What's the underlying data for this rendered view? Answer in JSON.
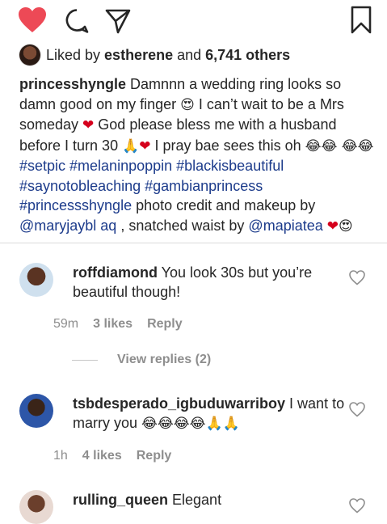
{
  "likes": {
    "prefix": "Liked by ",
    "user": "estherene",
    "mid": " and ",
    "count": "6,741 others"
  },
  "caption": {
    "user": "princesshyngle",
    "text1": " Damnnn a wedding ring looks so damn good on my finger ",
    "text2": " I can’t wait to be a Mrs someday ",
    "text3": " God please bless me with a husband before I turn 30 ",
    "text4": " I pray bae sees this oh ",
    "tags1": "#setpic #melaninpoppin #blackisbeautiful #saynotobleaching #gambianprincess #princessshyngle",
    "text5": " photo credit and makeup by ",
    "mention1": "@maryjaybl aq",
    "text6": " , snatched waist by ",
    "mention2": "@mapiatea"
  },
  "comments": [
    {
      "user": "roffdiamond",
      "text": " You look 30s but you’re beautiful though!",
      "time": "59m",
      "likes": "3 likes",
      "reply": "Reply"
    },
    {
      "user": "tsbdesperado_igbuduwarriboy",
      "text": " I want to marry you ",
      "time": "1h",
      "likes": "4 likes",
      "reply": "Reply"
    },
    {
      "user": "rulling_queen",
      "text": " Elegant"
    }
  ],
  "view_replies": "View replies (2)",
  "icons": [
    "heart-filled-icon",
    "comment-icon",
    "share-icon",
    "bookmark-icon",
    "heart-outline-icon"
  ],
  "colors": {
    "accent_red": "#ed4956",
    "link_blue": "#1c3b8b",
    "muted": "#8e8e8e"
  }
}
